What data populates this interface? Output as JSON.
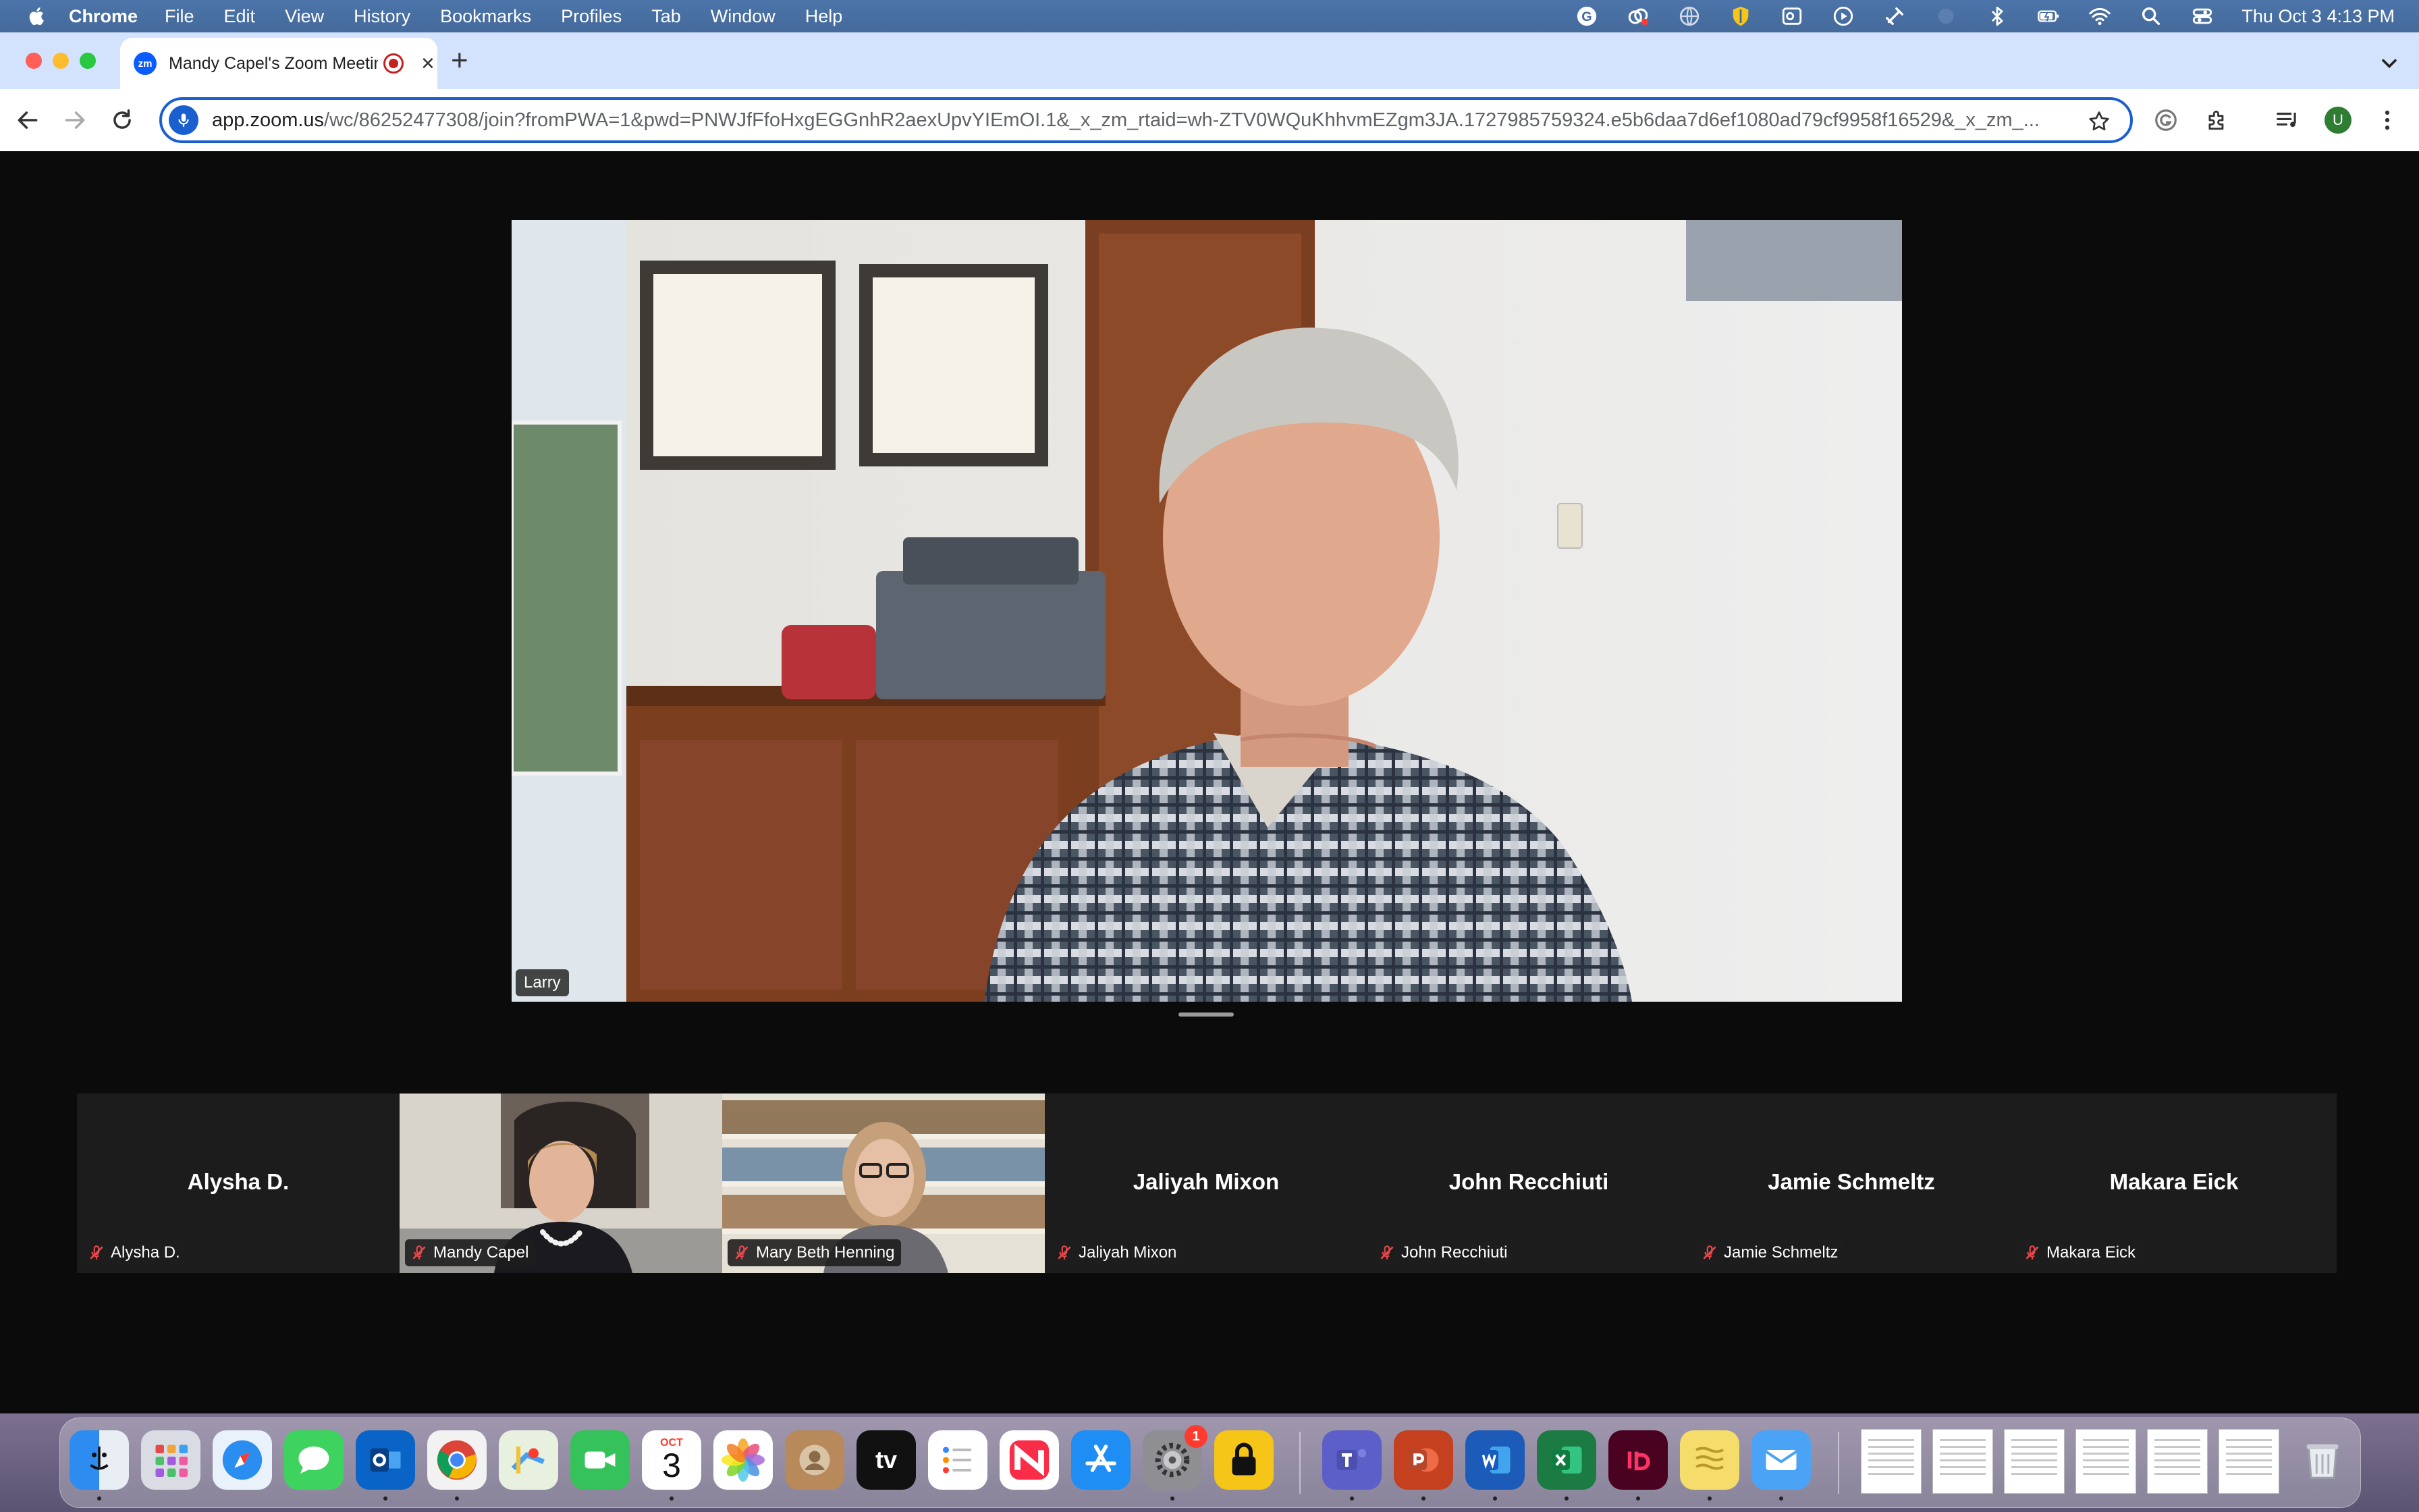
{
  "menubar": {
    "items": [
      "Chrome",
      "File",
      "Edit",
      "View",
      "History",
      "Bookmarks",
      "Profiles",
      "Tab",
      "Window",
      "Help"
    ],
    "clock": "Thu Oct 3  4:13 PM"
  },
  "browser": {
    "tab_title": "Mandy Capel's Zoom Meeting",
    "favicon_text": "zm",
    "url_host": "app.zoom.us",
    "url_path": "/wc/86252477308/join?fromPWA=1&pwd=PNWJfFfoHxgEGGnhR2aexUpvYIEmOI.1&_x_zm_rtaid=wh-ZTV0WQuKhhvmEZgm3JA.1727985759324.e5b6daa7d6ef1080ad79cf9958f16529&_x_zm_...",
    "profile_initial": "U"
  },
  "meeting": {
    "active_speaker": "Larry",
    "participants": [
      {
        "display": "Alysha D.",
        "label": "Alysha D.",
        "video": false
      },
      {
        "display": "",
        "label": "Mandy Capel",
        "video": true
      },
      {
        "display": "",
        "label": "Mary Beth Henning",
        "video": true
      },
      {
        "display": "Jaliyah Mixon",
        "label": "Jaliyah Mixon",
        "video": false
      },
      {
        "display": "John Recchiuti",
        "label": "John Recchiuti",
        "video": false
      },
      {
        "display": "Jamie Schmeltz",
        "label": "Jamie Schmeltz",
        "video": false
      },
      {
        "display": "Makara Eick",
        "label": "Makara Eick",
        "video": false
      }
    ]
  },
  "dock": {
    "calendar_month": "OCT",
    "calendar_day": "3",
    "appletv_label": "tv",
    "settings_badge": "1"
  },
  "colors": {
    "accent": "#1a5fd0",
    "zoom_blue": "#0b5cff",
    "meeting_bg": "#0b0b0b",
    "tile_bg": "#1c1c1c",
    "mute_red": "#e5484d"
  }
}
